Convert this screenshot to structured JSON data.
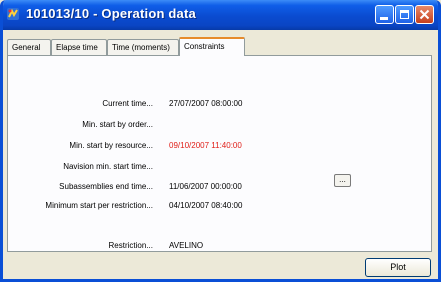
{
  "window": {
    "title": "101013/10 - Operation data",
    "icon": "app-icon",
    "controls": [
      "minimize-icon",
      "maximize-icon",
      "close-icon"
    ]
  },
  "tabs": [
    {
      "label": "General",
      "active": false
    },
    {
      "label": "Elapse time",
      "active": false
    },
    {
      "label": "Time (moments)",
      "active": false
    },
    {
      "label": "Constraints",
      "active": true
    }
  ],
  "fields": {
    "current_time": {
      "label": "Current time...",
      "value": "27/07/2007 08:00:00"
    },
    "min_start_order": {
      "label": "Min. start by order...",
      "value": ""
    },
    "min_start_resource": {
      "label": "Min. start by resource...",
      "value": "09/10/2007 11:40:00",
      "color": "#e0201a"
    },
    "navision_min_start": {
      "label": "Navision min. start time...",
      "value": ""
    },
    "subassemblies_end": {
      "label": "Subassemblies end time...",
      "value": "11/06/2007 00:00:00"
    },
    "min_start_restriction": {
      "label": "Minimum start per restriction...",
      "value": "04/10/2007 08:40:00"
    },
    "restriction": {
      "label": "Restriction...",
      "value": "AVELINO"
    }
  },
  "buttons": {
    "ellipsis_label": "...",
    "plot_label": "Plot"
  },
  "colors": {
    "titlebar": "#0a4bd0",
    "window_bg": "#ece9d8",
    "panel_bg": "#fcfcfe",
    "active_tab_accent": "#e68b2c",
    "highlight_value": "#e0201a"
  }
}
